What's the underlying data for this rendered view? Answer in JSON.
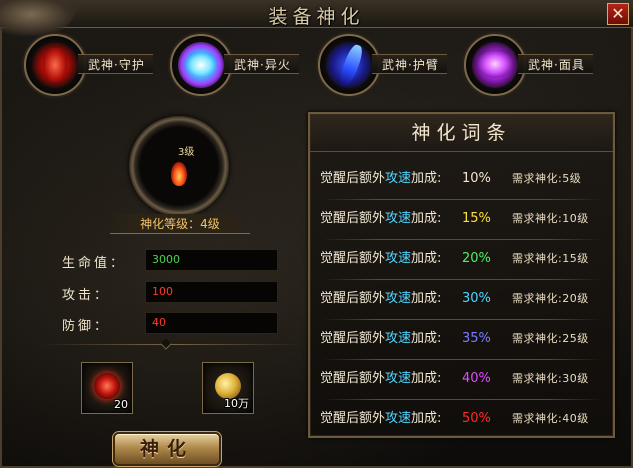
{
  "window": {
    "title": "装备神化",
    "close_label": "✕"
  },
  "tabs": [
    {
      "label": "武神·守护",
      "icon": "red-demon-emblem-icon",
      "color": "#e01818"
    },
    {
      "label": "武神·异火",
      "icon": "blue-lotus-flame-icon",
      "color": "#58d8ff"
    },
    {
      "label": "武神·护臂",
      "icon": "blue-bracer-icon",
      "color": "#3a6cff"
    },
    {
      "label": "武神·面具",
      "icon": "purple-mask-icon",
      "color": "#c04cff"
    }
  ],
  "equipment": {
    "level_tag": "3级",
    "icon": "flame-gem-icon"
  },
  "god_level": "神化等级：4级",
  "stats": [
    {
      "label": "生命值：",
      "value": "3000",
      "color": "#4ad24a"
    },
    {
      "label": "攻击：",
      "value": "100",
      "color": "#ff3a2a"
    },
    {
      "label": "防御：",
      "value": "40",
      "color": "#ff3a2a"
    }
  ],
  "materials": [
    {
      "icon": "red-dragon-orb-icon",
      "qty": "20"
    },
    {
      "icon": "gold-coin-icon",
      "qty": "10万"
    }
  ],
  "god_button": "神化",
  "affix_panel": {
    "title": "神化词条",
    "rows": [
      {
        "prefix": "觉醒后额外",
        "keyword": "攻速",
        "suffix": "加成:",
        "value": "10%",
        "value_color": "#f1e8d4",
        "req": "需求神化:5级"
      },
      {
        "prefix": "觉醒后额外",
        "keyword": "攻速",
        "suffix": "加成:",
        "value": "15%",
        "value_color": "#ffe03a",
        "req": "需求神化:10级"
      },
      {
        "prefix": "觉醒后额外",
        "keyword": "攻速",
        "suffix": "加成:",
        "value": "20%",
        "value_color": "#4ef06a",
        "req": "需求神化:15级"
      },
      {
        "prefix": "觉醒后额外",
        "keyword": "攻速",
        "suffix": "加成:",
        "value": "30%",
        "value_color": "#4fd6ff",
        "req": "需求神化:20级"
      },
      {
        "prefix": "觉醒后额外",
        "keyword": "攻速",
        "suffix": "加成:",
        "value": "35%",
        "value_color": "#7c7cff",
        "req": "需求神化:25级"
      },
      {
        "prefix": "觉醒后额外",
        "keyword": "攻速",
        "suffix": "加成:",
        "value": "40%",
        "value_color": "#e04cff",
        "req": "需求神化:30级"
      },
      {
        "prefix": "觉醒后额外",
        "keyword": "攻速",
        "suffix": "加成:",
        "value": "50%",
        "value_color": "#ff2a2a",
        "req": "需求神化:40级"
      }
    ]
  }
}
